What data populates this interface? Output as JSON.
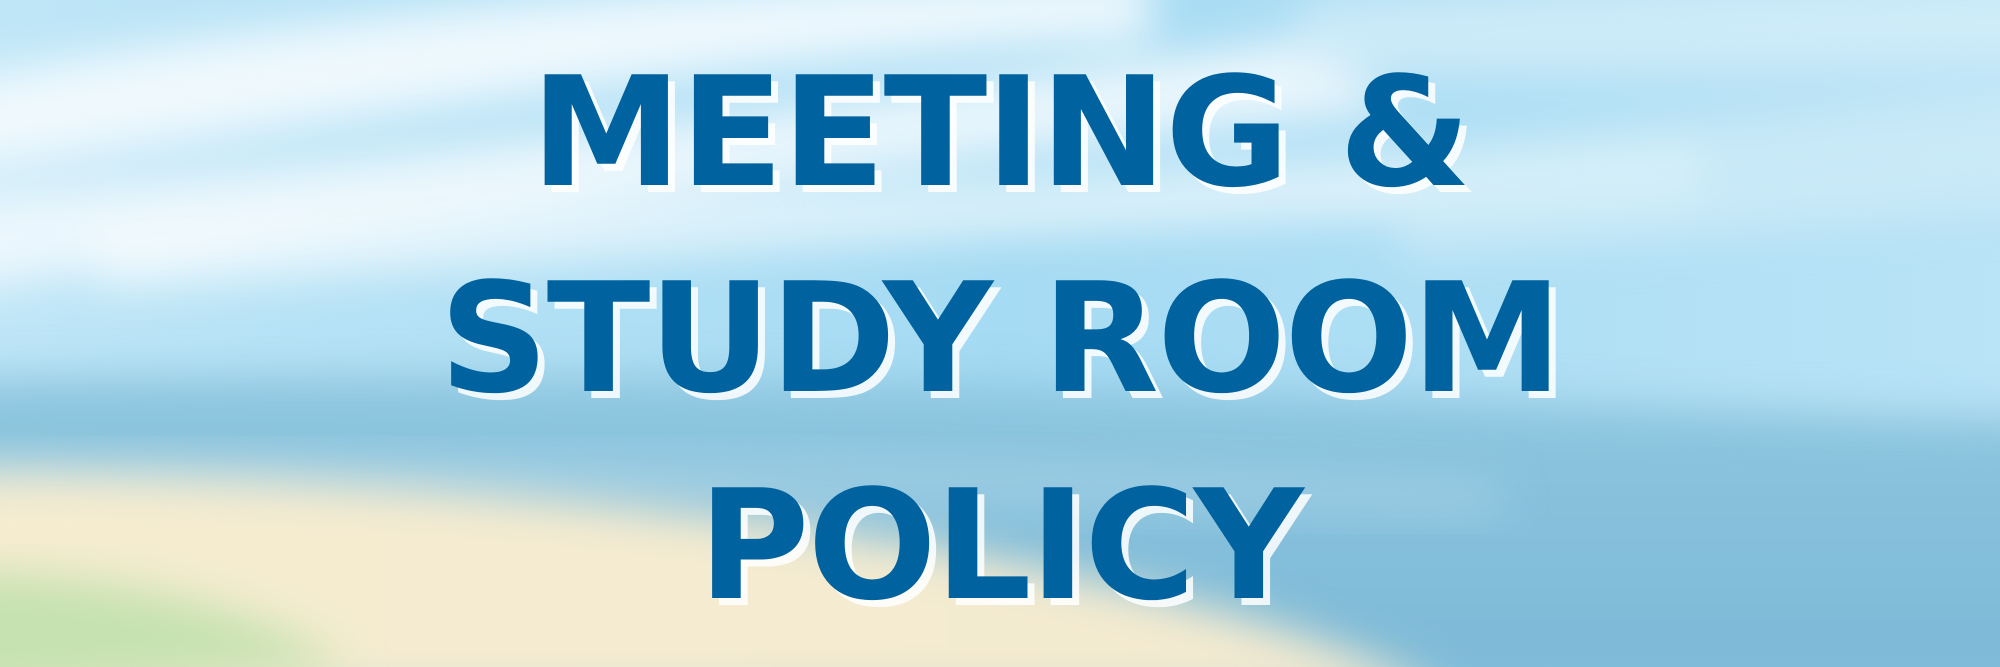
{
  "title": {
    "line1": "MEETING &",
    "line2": "STUDY ROOM",
    "line3": "POLICY"
  },
  "colors": {
    "text": "#00629e",
    "text_shadow": "#ffffff",
    "sky": "#a9dcf2",
    "water": "#7ebbd8",
    "sand": "#f7eed3",
    "grass": "#c8e3b3"
  }
}
